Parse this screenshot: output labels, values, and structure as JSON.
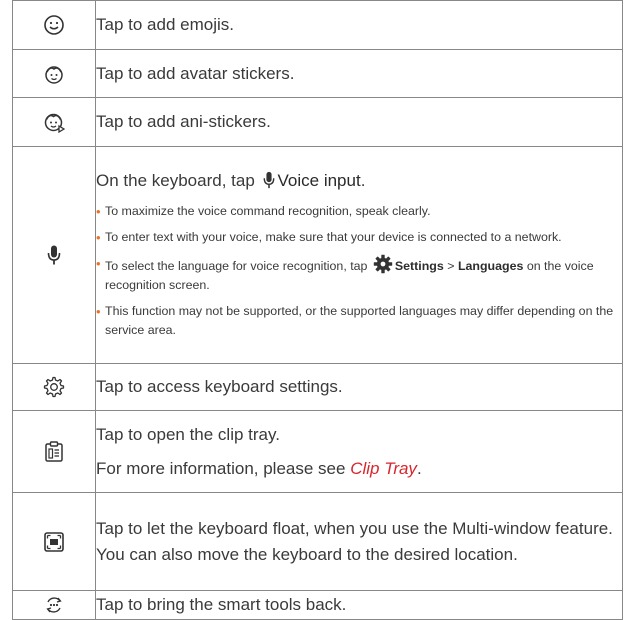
{
  "rows": {
    "emoji": {
      "icon": "smiley-icon",
      "text": "Tap to add emojis."
    },
    "avatar": {
      "icon": "avatar-face-icon",
      "text": "Tap to add avatar stickers."
    },
    "ani": {
      "icon": "animated-face-icon",
      "text": "Tap to add ani-stickers."
    },
    "voice": {
      "icon": "microphone-icon",
      "lead_pre": "On the keyboard, tap",
      "lead_bold": "Voice input",
      "lead_post": ".",
      "b1": "To maximize the voice command recognition, speak clearly.",
      "b2": "To enter text with your voice, make sure that your device is connected to a network.",
      "b3_pre": "To select the language for voice recognition, tap",
      "b3_settings": "Settings",
      "b3_sep": ">",
      "b3_languages": "Languages",
      "b3_post": "on the voice recognition screen.",
      "b4": "This function may not be supported, or the supported languages may differ depending on the service area."
    },
    "settings": {
      "icon": "gear-icon",
      "text": "Tap to access keyboard settings."
    },
    "clip": {
      "icon": "clip-tray-icon",
      "text1": "Tap to open the clip tray.",
      "text2_pre": "For more information, please see",
      "link": "Clip Tray",
      "text2_post": "."
    },
    "float": {
      "icon": "float-keyboard-icon",
      "text": "Tap to let the keyboard float, when you use the Multi-window feature. You can also move the keyboard to the desired location."
    },
    "smart": {
      "icon": "smart-tools-icon",
      "text": "Tap to bring the smart tools back."
    }
  },
  "colors": {
    "bullet": "#e8742c",
    "link": "#d7262c",
    "border": "#888888"
  }
}
